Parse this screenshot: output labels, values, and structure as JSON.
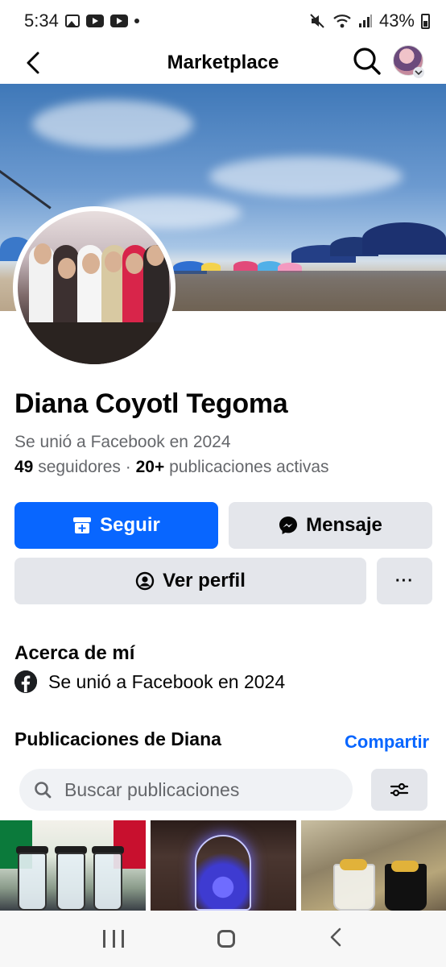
{
  "status_bar": {
    "time": "5:34",
    "battery": "43%"
  },
  "nav": {
    "title": "Marketplace"
  },
  "profile": {
    "name": "Diana Coyotl Tegoma",
    "joined": "Se unió a Facebook en 2024",
    "followers_count": "49",
    "followers_label": "seguidores",
    "separator": "·",
    "posts_count": "20+",
    "posts_label": "publicaciones activas"
  },
  "actions": {
    "follow_label": "Seguir",
    "message_label": "Mensaje",
    "view_profile_label": "Ver perfil",
    "more_label": "···"
  },
  "about": {
    "title": "Acerca de mí",
    "joined": "Se unió a Facebook en 2024"
  },
  "posts": {
    "title": "Publicaciones de Diana",
    "share_label": "Compartir",
    "search_placeholder": "Buscar publicaciones"
  },
  "colors": {
    "accent": "#0866ff",
    "button_grey": "#e4e6eb",
    "secondary_text": "#65676b"
  },
  "icons": {
    "status": [
      "gallery-icon",
      "youtube-icon",
      "youtube-icon",
      "dot-icon",
      "mute-icon",
      "wifi-icon",
      "signal-icon",
      "battery-icon"
    ],
    "nav": [
      "back-arrow-icon",
      "search-icon",
      "avatar"
    ],
    "buttons": [
      "store-icon",
      "messenger-icon",
      "user-circle-icon",
      "more-icon"
    ],
    "about": [
      "facebook-icon"
    ],
    "search": [
      "search-icon",
      "filter-icon"
    ],
    "system": [
      "recents-icon",
      "home-icon",
      "back-icon"
    ]
  }
}
